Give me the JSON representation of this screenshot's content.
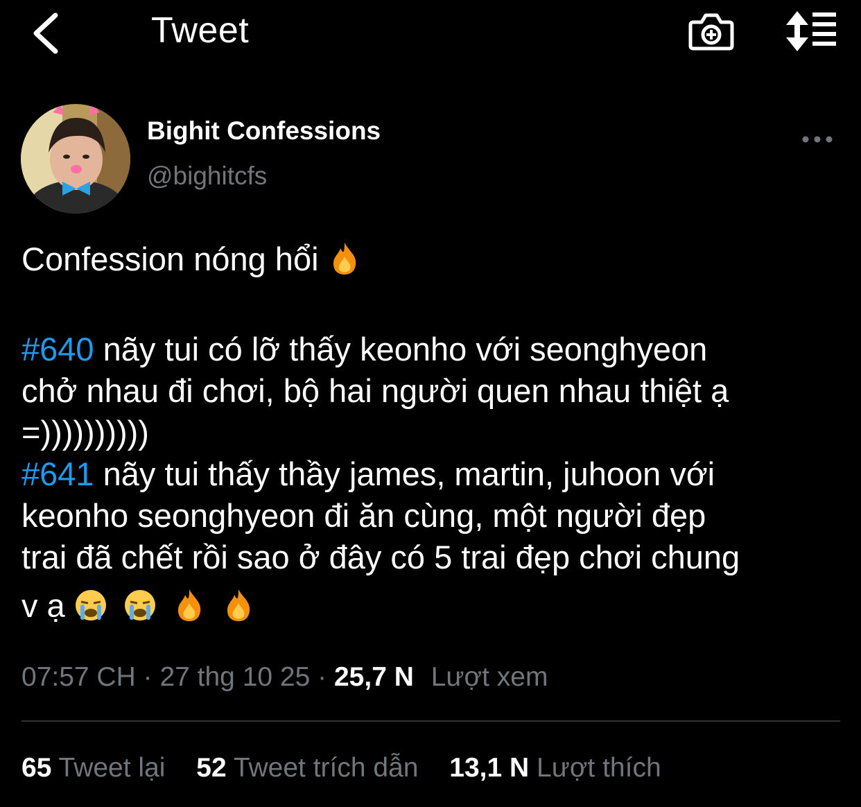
{
  "header": {
    "title": "Tweet",
    "back_icon": "chevron-left-icon",
    "camera_icon": "camera-add-icon",
    "sort_icon": "sort-icon"
  },
  "author": {
    "display_name": "Bighit Confessions",
    "handle": "@bighitcfs",
    "more_icon": "more-horizontal-icon"
  },
  "tweet": {
    "line1": "Confession nóng hổi",
    "hashtag1": "#640",
    "line2_rest": " nãy tui có lỡ thấy keonho với seonghyeon",
    "line3": "chở nhau đi chơi, bộ hai người quen nhau thiệt ạ",
    "line4": "=))))))))))",
    "hashtag2": "#641",
    "line5_rest": " nãy tui thấy thầy james, martin, juhoon với",
    "line6": "keonho seonghyeon đi ăn cùng, một người đẹp",
    "line7": "trai đã chết rồi sao ở đây có 5 trai đẹp chơi chung",
    "line8": "v ạ"
  },
  "meta": {
    "time": "07:57 CH",
    "sep": " · ",
    "date": "27 thg 10 25",
    "views_count": "25,7 N",
    "views_label": "Lượt xem"
  },
  "stats": {
    "retweets_count": "65",
    "retweets_label": "Tweet lại",
    "quotes_count": "52",
    "quotes_label": "Tweet trích dẫn",
    "likes_count": "13,1 N",
    "likes_label": "Lượt thích"
  },
  "colors": {
    "background": "#000000",
    "text": "#ffffff",
    "muted": "#71767b",
    "link": "#1d9bf0",
    "divider": "#2f3336"
  }
}
